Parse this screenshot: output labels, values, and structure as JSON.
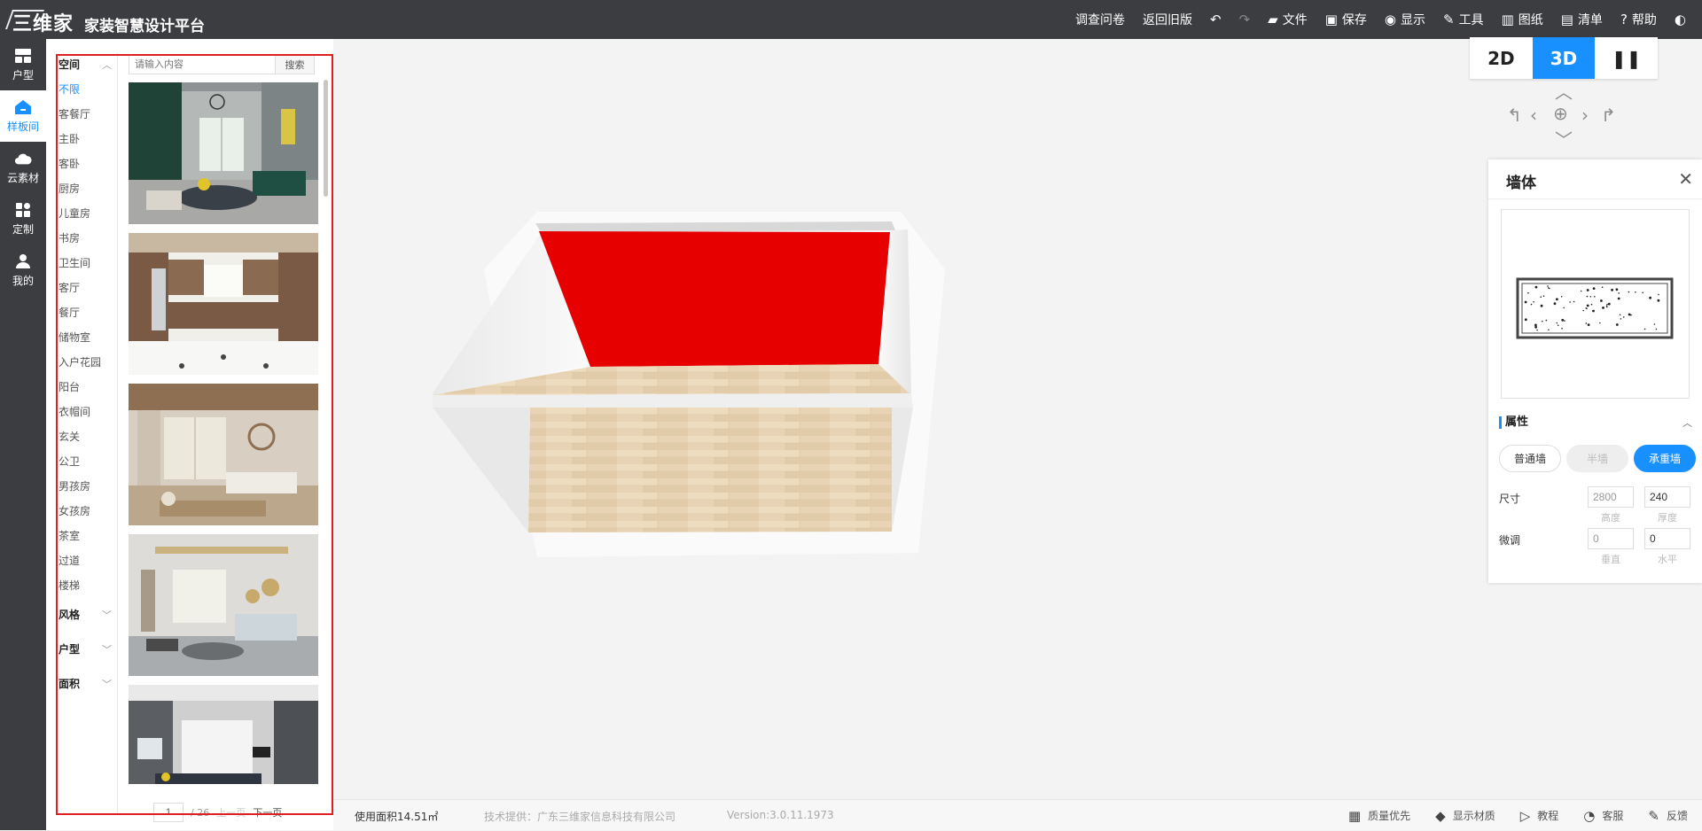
{
  "topbar": {
    "logo_text": "三维家",
    "title": "家装智慧设计平台",
    "menu": {
      "survey": "调查问卷",
      "old_version": "返回旧版",
      "file": "文件",
      "save": "保存",
      "display": "显示",
      "tools": "工具",
      "drawings": "图纸",
      "list": "清单",
      "help": "帮助"
    }
  },
  "left_nav": {
    "items": [
      {
        "label": "户型",
        "icon": "floorplan-icon"
      },
      {
        "label": "样板间",
        "icon": "home-icon",
        "active": true
      },
      {
        "label": "云素材",
        "icon": "cloud-icon"
      },
      {
        "label": "定制",
        "icon": "grid-icon"
      },
      {
        "label": "我的",
        "icon": "user-icon"
      }
    ]
  },
  "filters": {
    "space_header": "空间",
    "space_items": [
      "不限",
      "客餐厅",
      "主卧",
      "客卧",
      "厨房",
      "儿童房",
      "书房",
      "卫生间",
      "客厅",
      "餐厅",
      "储物室",
      "入户花园",
      "阳台",
      "衣帽间",
      "玄关",
      "公卫",
      "男孩房",
      "女孩房",
      "茶室",
      "过道",
      "楼梯"
    ],
    "selected": "不限",
    "style_header": "风格",
    "layout_header": "户型",
    "area_header": "面积"
  },
  "search": {
    "placeholder": "请输入内容",
    "button": "搜索"
  },
  "pager": {
    "current": "1",
    "total": "/ 26",
    "prev": "上一页",
    "next": "下一页"
  },
  "view_mode": {
    "mode_2d": "2D",
    "mode_3d": "3D",
    "active": "3D"
  },
  "properties": {
    "title": "墙体",
    "section": "属性",
    "wall_types": [
      "普通墙",
      "半墙",
      "承重墙"
    ],
    "active_type": "承重墙",
    "size_label": "尺寸",
    "height_value": "2800",
    "height_label": "高度",
    "thickness_value": "240",
    "thickness_label": "厚度",
    "adjust_label": "微调",
    "vertical_value": "0",
    "vertical_label": "垂直",
    "horizontal_value": "0",
    "horizontal_label": "水平"
  },
  "status": {
    "area": "使用面积14.51㎡",
    "tech": "技术提供：广东三维家信息科技有限公司",
    "version": "Version:3.0.11.1973",
    "quality": "质量优先",
    "show_material": "显示材质",
    "tutorial": "教程",
    "service": "客服",
    "feedback": "反馈"
  },
  "colors": {
    "accent": "#1890ff",
    "topbar": "#3b3d40",
    "wall_selected": "#e60000",
    "highlight_border": "#e02020",
    "floor": "#e8d4b4"
  }
}
